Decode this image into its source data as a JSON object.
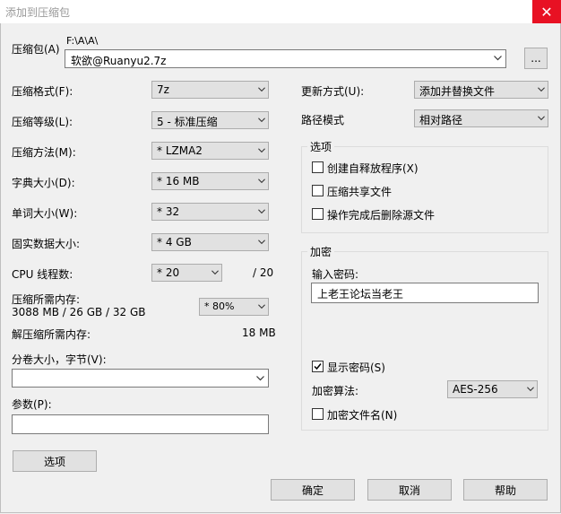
{
  "window": {
    "title": "添加到压缩包",
    "close_glyph": "✕"
  },
  "archive": {
    "label": "压缩包(A)",
    "path": "F:\\A\\A\\",
    "filename": "软欲@Ruanyu2.7z",
    "browse_label": "..."
  },
  "left": {
    "format_label": "压缩格式(F):",
    "format_value": "7z",
    "level_label": "压缩等级(L):",
    "level_value": "5 - 标准压缩",
    "method_label": "压缩方法(M):",
    "method_value": "* LZMA2",
    "dict_label": "字典大小(D):",
    "dict_value": "* 16 MB",
    "word_label": "单词大小(W):",
    "word_value": "* 32",
    "solid_label": "固实数据大小:",
    "solid_value": "* 4 GB",
    "threads_label": "CPU 线程数:",
    "threads_value": "* 20",
    "threads_max": "/ 20",
    "mem_label": "压缩所需内存:",
    "mem_detail": "3088 MB / 26 GB / 32 GB",
    "mem_value": "* 80%",
    "decomp_label": "解压缩所需内存:",
    "decomp_value": "18 MB",
    "split_label": "分卷大小，字节(V):",
    "split_value": "",
    "params_label": "参数(P):",
    "params_value": "",
    "options_button": "选项"
  },
  "right": {
    "update_label": "更新方式(U):",
    "update_value": "添加并替换文件",
    "path_label": "路径模式",
    "path_value": "相对路径",
    "options_group": "选项",
    "opt_sfx": "创建自释放程序(X)",
    "opt_shared": "压缩共享文件",
    "opt_delete": "操作完成后删除源文件",
    "encrypt_group": "加密",
    "password_label": "输入密码:",
    "password_value": "上老王论坛当老王",
    "show_password": "显示密码(S)",
    "algo_label": "加密算法:",
    "algo_value": "AES-256",
    "encrypt_names": "加密文件名(N)"
  },
  "checks": {
    "sfx": false,
    "shared": false,
    "delete": false,
    "show_password": true,
    "encrypt_names": false
  },
  "footer": {
    "ok": "确定",
    "cancel": "取消",
    "help": "帮助"
  }
}
